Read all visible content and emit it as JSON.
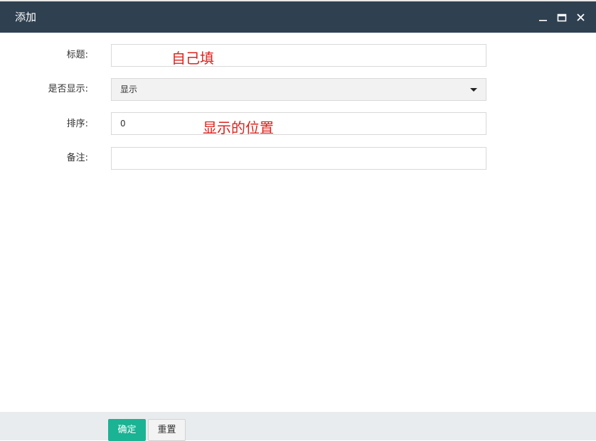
{
  "dialog": {
    "title": "添加",
    "minimize_icon": "minimize-icon",
    "maximize_icon": "maximize-icon",
    "close_icon": "close-icon",
    "header_color": "#2f4050"
  },
  "form": {
    "title_label": "标题:",
    "title_value": "",
    "display_label": "是否显示:",
    "display_selected": "显示",
    "sort_label": "排序:",
    "sort_value": "0",
    "remark_label": "备注:",
    "remark_value": ""
  },
  "annotations": {
    "title_note": "自己填",
    "sort_note": "显示的位置",
    "color": "#e0211b"
  },
  "footer": {
    "confirm_label": "确定",
    "reset_label": "重置",
    "confirm_color": "#1ab394"
  }
}
